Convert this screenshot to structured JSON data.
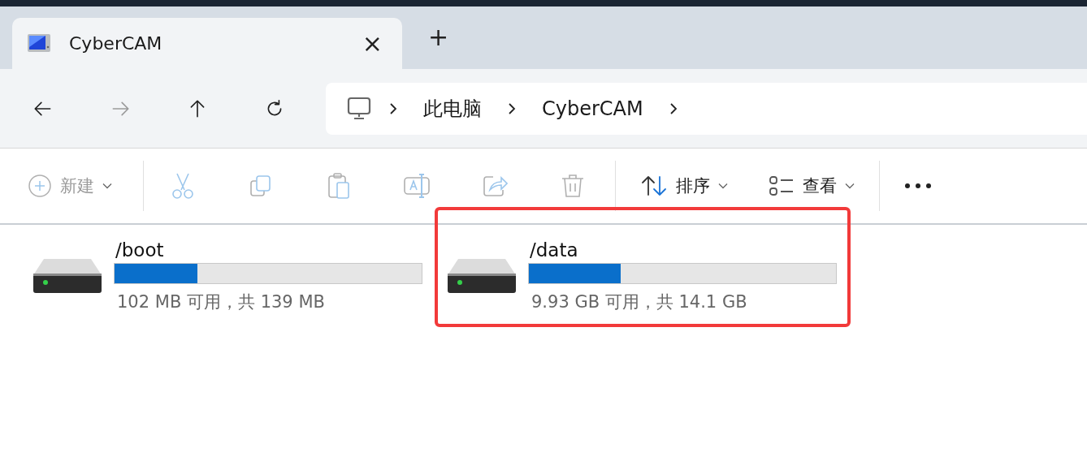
{
  "tab": {
    "title": "CyberCAM",
    "close": "×",
    "new_tab": "+"
  },
  "nav": [
    {
      "kind": "back",
      "disabled": false
    },
    {
      "kind": "forward",
      "disabled": true
    },
    {
      "kind": "up",
      "disabled": false
    },
    {
      "kind": "refresh",
      "disabled": false
    }
  ],
  "address": {
    "crumbs": [
      "此电脑",
      "CyberCAM"
    ]
  },
  "toolbar": [
    {
      "kind": "new",
      "label": "新建",
      "disabled": true
    },
    {
      "kind": "cut",
      "disabled": true
    },
    {
      "kind": "copy",
      "disabled": true
    },
    {
      "kind": "paste",
      "disabled": true
    },
    {
      "kind": "rename",
      "disabled": true
    },
    {
      "kind": "share",
      "disabled": true
    },
    {
      "kind": "delete",
      "disabled": true
    },
    {
      "kind": "sort",
      "label": "排序",
      "disabled": false
    },
    {
      "kind": "view",
      "label": "查看",
      "disabled": false
    },
    {
      "kind": "more",
      "disabled": false
    }
  ],
  "drives": [
    {
      "name": "/boot",
      "level": 0.27,
      "space": "102 MB 可用，共 139 MB",
      "highlighted": false
    },
    {
      "name": "/data",
      "level": 0.3,
      "space": "9.93 GB 可用，共 14.1 GB",
      "highlighted": true
    }
  ]
}
